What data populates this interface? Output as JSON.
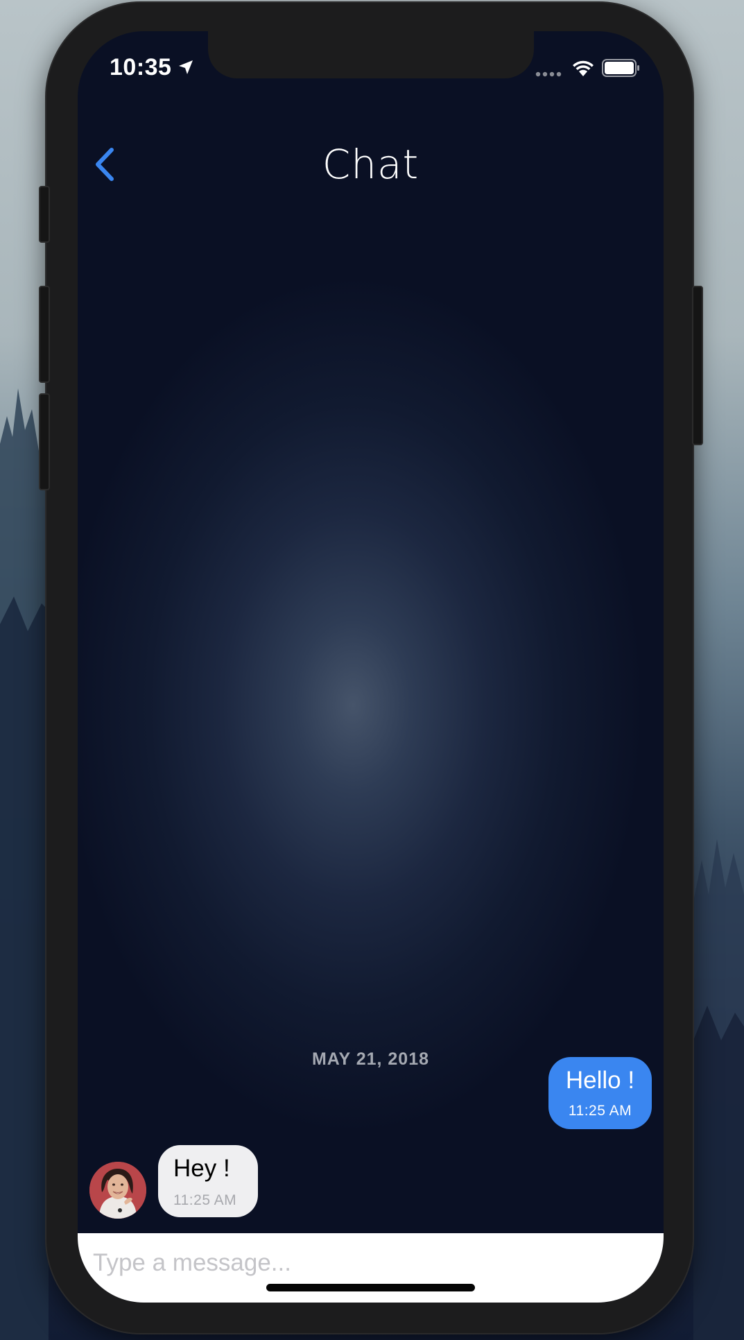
{
  "status_bar": {
    "time": "10:35",
    "icons": [
      "location-arrow-icon",
      "signal-icon",
      "wifi-icon",
      "battery-icon"
    ]
  },
  "nav": {
    "title": "Chat",
    "back_icon": "chevron-left-icon"
  },
  "conversation": {
    "date_separator": "MAY 21, 2018",
    "messages": [
      {
        "direction": "outgoing",
        "text": "Hello !",
        "time": "11:25 AM"
      },
      {
        "direction": "incoming",
        "text": "Hey !",
        "time": "11:25 AM"
      }
    ]
  },
  "composer": {
    "placeholder": "Type a message..."
  },
  "colors": {
    "accent": "#3a86f0",
    "incoming_bubble": "#efeff1",
    "screen_background": "#0a1024"
  }
}
